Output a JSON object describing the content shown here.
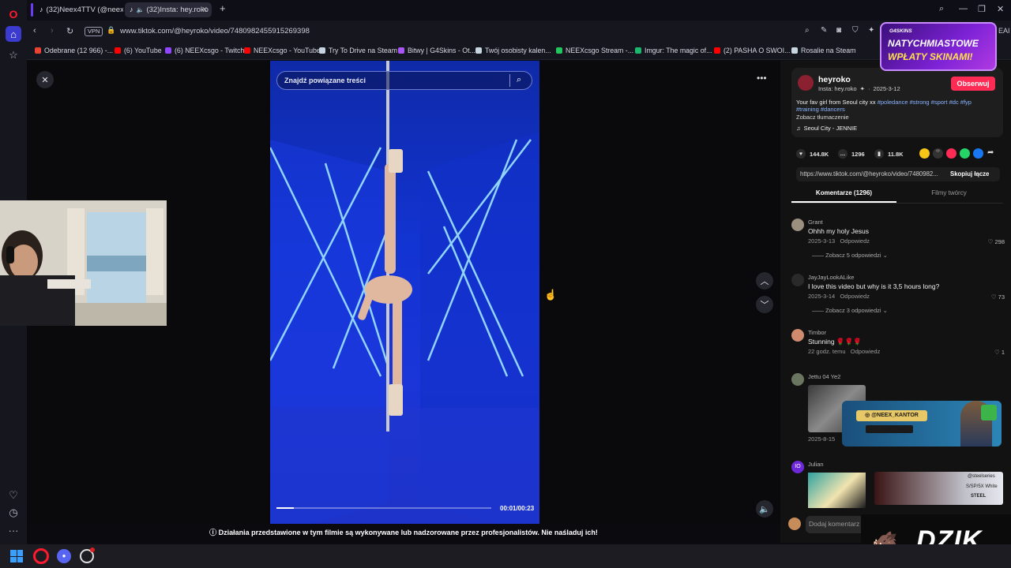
{
  "tabs": [
    {
      "label": "(32)Neex4TTV (@neex4ttv"
    },
    {
      "label": "(32)Insta: hey.roko"
    }
  ],
  "address": {
    "vpn_label": "VPN",
    "url": "www.tiktok.com/@heyroko/video/7480982455915269398"
  },
  "bookmarks": [
    {
      "label": "Odebrane (12 966) -...",
      "color": "#ea4335"
    },
    {
      "label": "(6) YouTube",
      "color": "#ff0000"
    },
    {
      "label": "(6) NEEXcsgo - Twitch",
      "color": "#9146ff"
    },
    {
      "label": "NEEXcsgo - YouTube",
      "color": "#ff0000"
    },
    {
      "label": "Try To Drive na Steam",
      "color": "#c7d5e0"
    },
    {
      "label": "Bitwy | G4Skins - Ot...",
      "color": "#a855f7"
    },
    {
      "label": "Twój osobisty kalen...",
      "color": "#c7d5e0"
    },
    {
      "label": "NEEXcsgo Stream -...",
      "color": "#22c55e"
    },
    {
      "label": "Imgur: The magic of...",
      "color": "#1bb76e"
    },
    {
      "label": "(2) PASHA O SWOI...",
      "color": "#ff0000"
    },
    {
      "label": "Rosalie na Steam",
      "color": "#c7d5e0"
    }
  ],
  "video": {
    "search_placeholder": "Znajdź powiązane treści",
    "time": "00:01/00:23",
    "progress": 0.08,
    "disclaimer": "Działania przedstawione w tym filmie są wykonywane lub nadzorowane przez profesjonalistów. Nie naśladuj ich!"
  },
  "author": {
    "name": "heyroko",
    "subtitle": "Insta: hey.roko",
    "date": "2025-3-12",
    "follow_label": "Obserwuj",
    "caption_text": "Your fav girl from Seoul city xx",
    "hashtags_1": "#poledance #strong #sport #dc #fyp",
    "hashtags_2": "#training #dancers",
    "translate_label": "Zobacz tłumaczenie",
    "music": "Seoul City - JENNIE"
  },
  "stats": {
    "likes": "144.8K",
    "comments": "1296",
    "saves": "11.8K"
  },
  "link": {
    "url": "https://www.tiktok.com/@heyroko/video/7480982...",
    "copy_label": "Skopiuj łącze"
  },
  "panel_tabs": {
    "comments": "Komentarze (1296)",
    "creator_videos": "Filmy twórcy"
  },
  "comments": [
    {
      "name": "Grant",
      "text": "Ohhh my holy Jesus",
      "date": "2025-3-13",
      "reply": "Odpowiedz",
      "likes": "298",
      "more": "Zobacz 5 odpowiedzi"
    },
    {
      "name": "JayJayLookALike",
      "text": "I love this video but why is it 3,5 hours long?",
      "date": "2025-3-14",
      "reply": "Odpowiedz",
      "likes": "73",
      "more": "Zobacz 3 odpowiedzi"
    },
    {
      "name": "Timbor",
      "text": "Stunning 🌹🌹🌹",
      "date": "22 godz. temu",
      "reply": "Odpowiedz",
      "likes": "1"
    },
    {
      "name": "Jettu 04 Ye2",
      "date": "2025-8-15"
    },
    {
      "name": "Julian",
      "avatar_letter": "IO"
    }
  ],
  "comment_input_placeholder": "Dodaj komentarz",
  "overlays": {
    "promo_brand": "G4SKINS",
    "promo_line1": "NATYCHMIASTOWE",
    "promo_line2": "WPŁATY SKINAMI!",
    "kantor_label": "@NEEX_KANTOR",
    "dzik_label": "DZIK",
    "julian_thumb_text": "@steelseries",
    "julian_thumb_text2": "S/SP/5X White",
    "julian_thumb_text3": "STEEL",
    "address_corner": "EAI"
  },
  "colors": {
    "accent": "#fe2c55",
    "hashtag": "#8ab4ff",
    "panel_bg": "#121212"
  }
}
